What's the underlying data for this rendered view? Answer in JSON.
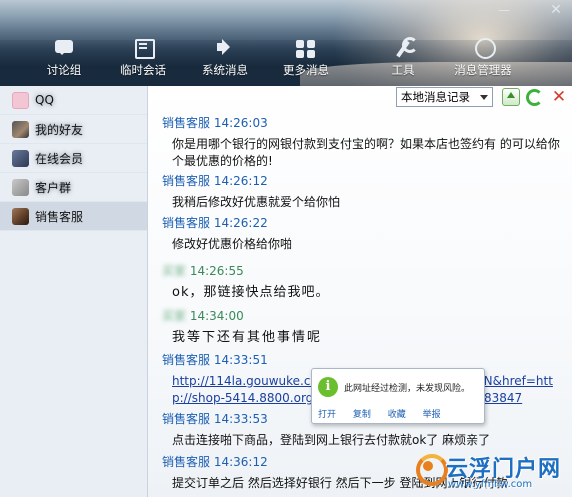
{
  "window": {
    "minimize_glyph": "—",
    "close_glyph": "✕"
  },
  "nav": [
    {
      "label": "讨论组",
      "icon": "chat-bubble-icon"
    },
    {
      "label": "临时会话",
      "icon": "temp-session-icon"
    },
    {
      "label": "系统消息",
      "icon": "speaker-icon"
    },
    {
      "label": "更多消息",
      "icon": "more-grid-icon"
    },
    {
      "label": "工具",
      "icon": "wrench-icon"
    },
    {
      "label": "消息管理器",
      "icon": "message-manager-icon"
    }
  ],
  "sidebar": {
    "contacts": [
      {
        "name": "QQ",
        "blurred": true
      },
      {
        "name": "我的好友",
        "blurred": true
      },
      {
        "name": "在线会员",
        "blurred": true
      },
      {
        "name": "客户群",
        "blurred": true
      },
      {
        "name": "销售客服",
        "blurred": false
      }
    ]
  },
  "toolbar": {
    "record_select": "本地消息记录"
  },
  "messages": [
    {
      "sender": "销售客服",
      "time": "14:26:03",
      "text": "你是用哪个银行的网银付款到支付宝的啊？如果本店也签约有 的可以给你个最优惠的价格的!"
    },
    {
      "sender": "销售客服",
      "time": "14:26:12",
      "text": "我稍后修改好优惠就爱个给你怕"
    },
    {
      "sender": "销售客服",
      "time": "14:26:22",
      "text": "修改好优惠价格给你啪"
    },
    {
      "sender": "买家",
      "time": "14:26:55",
      "text": "ok，那链接快点给我吧。"
    },
    {
      "sender": "买家",
      "time": "14:34:00",
      "text": "我等下还有其他事情呢"
    },
    {
      "sender": "销售客服",
      "time": "14:33:51",
      "link_line1": "http://114la.gouwuke.co",
      "link_line1_end": "{N&href=htt",
      "link_line2": "p://shop-5414.8800.org",
      "link_line2_end": "83847"
    },
    {
      "sender": "销售客服",
      "time": "14:33:53",
      "text": "点击连接啪下商品，登陆到网上银行去付款就ok了 麻烦亲了"
    },
    {
      "sender": "销售客服",
      "time": "14:36:12",
      "text": "提交订单之后  然后选择好银行 然后下一步  登陆到网上银行付款"
    }
  ],
  "popup": {
    "icon_glyph": "i",
    "text": "此网址经过检测，未发现风险。",
    "actions": [
      "打开",
      "复制",
      "收藏",
      "举报"
    ]
  },
  "watermark": {
    "title": "云浮门户网",
    "url": "www.yfmhw.com"
  }
}
